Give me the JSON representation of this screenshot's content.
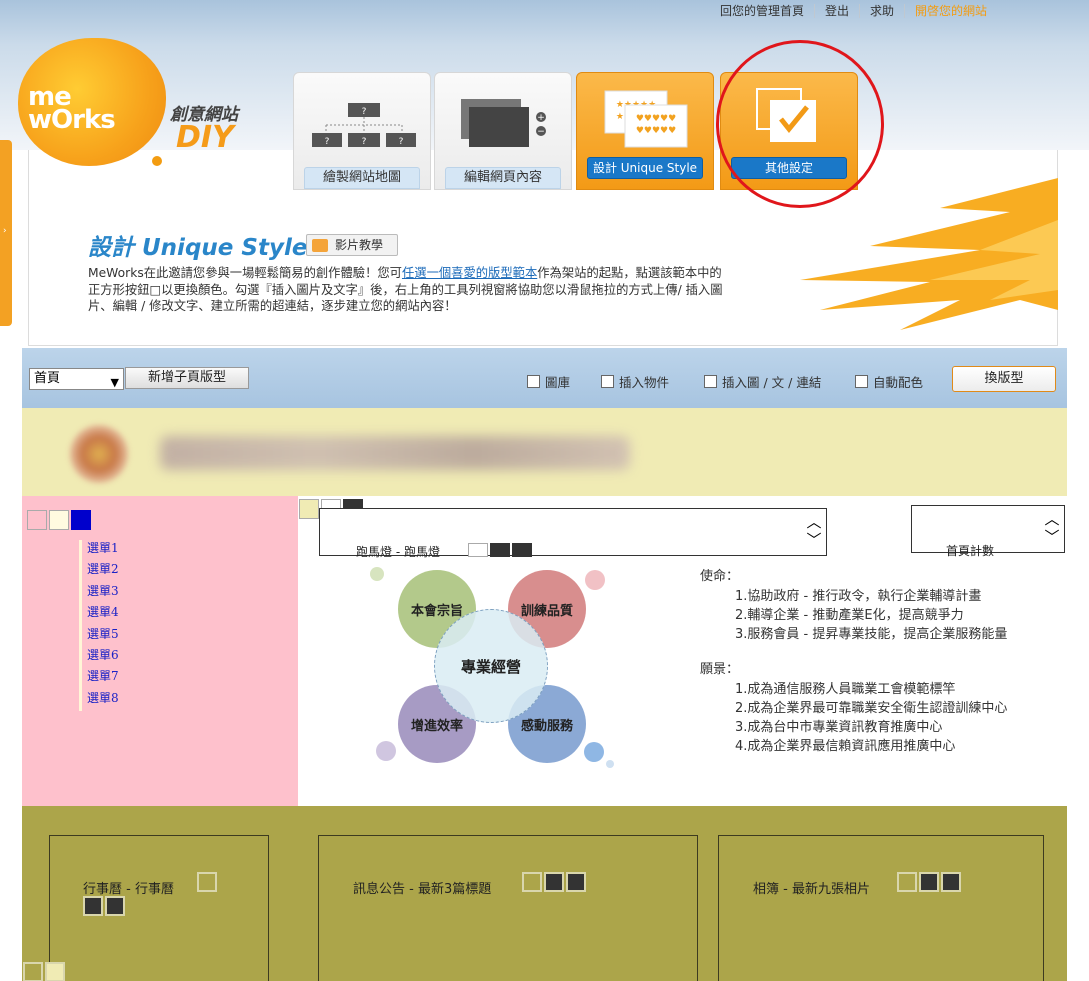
{
  "topnav": {
    "items": [
      "回您的管理首頁",
      "登出",
      "求助",
      "開啓您的網站"
    ]
  },
  "left_tab": {
    "icon": "chevron-right-icon"
  },
  "logo": {
    "brand_top": "me",
    "brand_bottom": "wOrks",
    "cn": "創意網站",
    "diy": "DIY"
  },
  "nav_cards": [
    {
      "label": "繪製網站地圖",
      "icon": "sitemap-icon"
    },
    {
      "label": "編輯網頁內容",
      "icon": "pages-icon"
    },
    {
      "label": "設計 Unique Style",
      "icon": "style-icon"
    },
    {
      "label": "其他設定",
      "icon": "checkbox-icon"
    }
  ],
  "sitemap_marks": [
    "?",
    "?",
    "?",
    "?"
  ],
  "section": {
    "title": "設計 Unique Style",
    "video_label": "影片教學",
    "desc_pre": "MeWorks在此邀請您參與一場輕鬆簡易的創作體驗！您可",
    "desc_link": "任選一個喜愛的版型範本",
    "desc_post": "作為架站的起點，點選該範本中的正方形按鈕□以更換顏色。勾選『插入圖片及文字』後，右上角的工具列視窗將協助您以滑鼠拖拉的方式上傳/ 插入圖片、編輯 / 修改文字、建立所需的超連結，逐步建立您的網站內容！"
  },
  "toolbar": {
    "page_select": "首頁",
    "new_page_label": "新增子頁版型",
    "checks": [
      "圖庫",
      "插入物件",
      "插入圖 / 文 / 連結",
      "自動配色"
    ],
    "switch_label": "換版型"
  },
  "sidebar": {
    "items": [
      "選單1",
      "選單2",
      "選單3",
      "選單4",
      "選單5",
      "選單6",
      "選單7",
      "選單8"
    ]
  },
  "marquee": {
    "text": "跑馬燈 - 跑馬燈"
  },
  "counter": {
    "text": "首頁計數"
  },
  "diagram": {
    "center": "專業經營",
    "tl": "本會宗旨",
    "tr": "訓練品質",
    "bl": "增進效率",
    "br": "感動服務"
  },
  "mission": {
    "title": "使命：",
    "items": [
      "1.協助政府 - 推行政令，執行企業輔導計畫",
      "2.輔導企業 - 推動產業E化，提高競爭力",
      "3.服務會員 - 提昇專業技能，提高企業服務能量"
    ]
  },
  "vision": {
    "title": "願景：",
    "items": [
      "1.成為通信服務人員職業工會模範標竿",
      "2.成為企業界最可靠職業安全衛生認證訓練中心",
      "3.成為台中市專業資訊教育推廣中心",
      "4.成為企業界最信賴資訊應用推廣中心"
    ]
  },
  "bottom": {
    "cal": "行事曆 - 行事曆",
    "news": "訊息公告 - 最新3篇標題",
    "album": "相簿 - 最新九張相片"
  }
}
